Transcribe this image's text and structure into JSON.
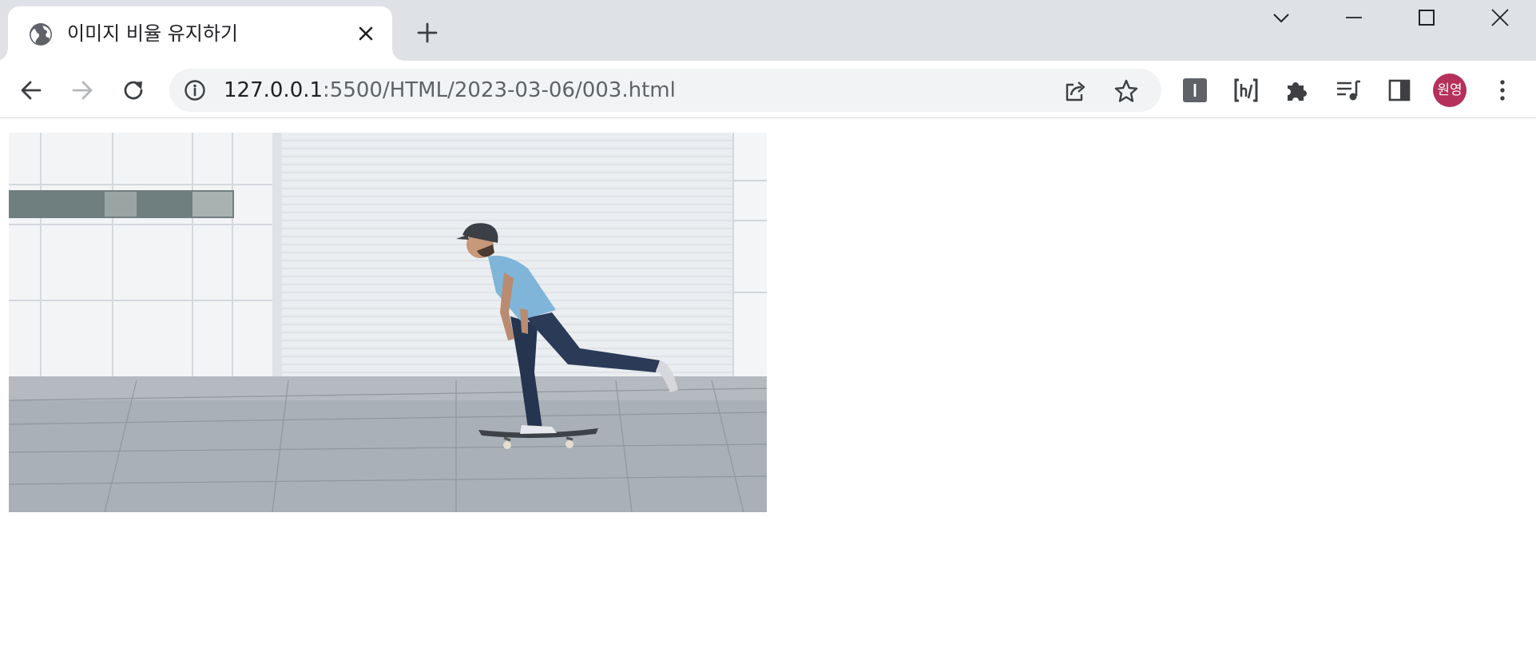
{
  "tab": {
    "title": "이미지 비율 유지하기",
    "favicon": "globe-icon"
  },
  "omnibox": {
    "url_host": "127.0.0.1",
    "url_path": ":5500/HTML/2023-03-06/003.html"
  },
  "profile": {
    "initials": "원영",
    "color": "#b5305b"
  },
  "icons": {
    "back": "arrow-left-icon",
    "forward": "arrow-right-icon",
    "reload": "reload-icon",
    "info": "info-icon",
    "share": "share-icon",
    "bookmark": "star-icon",
    "extension_1": "i-box-icon",
    "extension_2": "hj-bracket-icon",
    "extensions": "puzzle-icon",
    "media": "playlist-icon",
    "side_panel": "side-panel-icon",
    "menu": "kebab-icon"
  }
}
